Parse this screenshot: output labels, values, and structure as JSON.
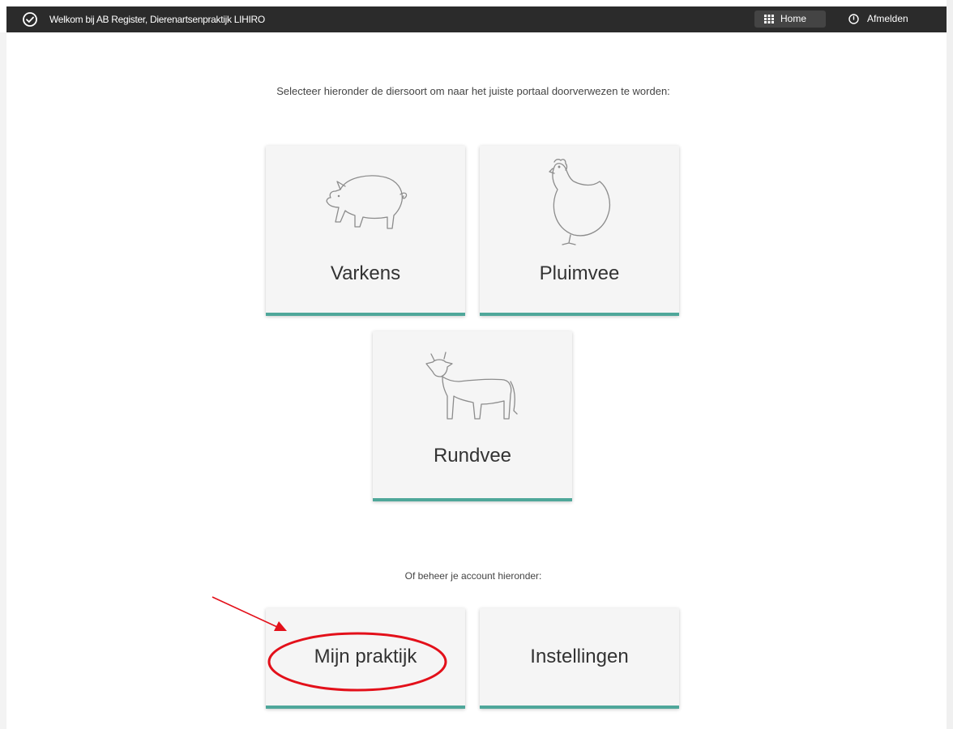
{
  "header": {
    "welcome_text": "Welkom bij AB Register, Dierenartsenpraktijk LIHIRO",
    "home_label": "Home",
    "logout_label": "Afmelden",
    "icons": {
      "status": "check-circle-icon",
      "home": "grid-icon",
      "logout": "power-icon"
    }
  },
  "main": {
    "intro_text": "Selecteer hieronder de diersoort om naar het juiste portaal doorverwezen te worden:",
    "species_tiles": [
      {
        "label": "Varkens",
        "icon": "pig-icon"
      },
      {
        "label": "Pluimvee",
        "icon": "chicken-icon"
      },
      {
        "label": "Rundvee",
        "icon": "cow-icon"
      }
    ],
    "account_intro": "Of beheer je account hieronder:",
    "account_tiles": [
      {
        "label": "Mijn praktijk"
      },
      {
        "label": "Instellingen"
      }
    ]
  },
  "colors": {
    "header_bg": "#2b2b2b",
    "tile_bg": "#f5f5f5",
    "tile_accent": "#4fa79a",
    "annotation_red": "#e3101a"
  }
}
